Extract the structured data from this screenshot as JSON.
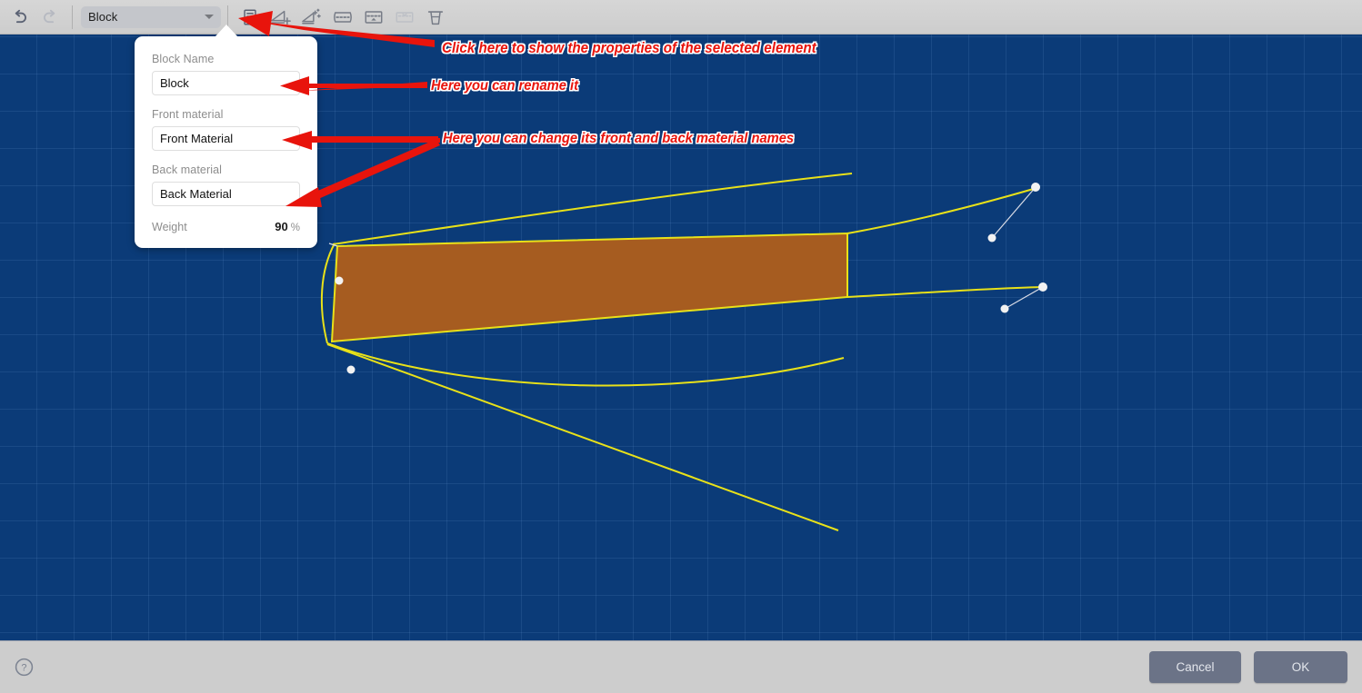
{
  "toolbar": {
    "undo_icon": "undo-arrow-icon",
    "redo_icon": "redo-arrow-icon",
    "element_select": {
      "value": "Block",
      "caret_icon": "chevron-down-icon"
    },
    "buttons": [
      {
        "name": "properties-button",
        "icon": "properties-list-icon",
        "enabled": true
      },
      {
        "name": "add-block-button",
        "icon": "add-block-icon",
        "enabled": true
      },
      {
        "name": "add-broadseam-button",
        "icon": "add-broadseam-icon",
        "enabled": true
      },
      {
        "name": "add-batten-button",
        "icon": "add-batten-icon",
        "enabled": true
      },
      {
        "name": "edit-batten-button",
        "icon": "edit-batten-icon",
        "enabled": true
      },
      {
        "name": "remove-batten-button",
        "icon": "remove-batten-icon",
        "enabled": false
      },
      {
        "name": "delete-button",
        "icon": "trash-icon",
        "enabled": true
      }
    ]
  },
  "properties_panel": {
    "block_name": {
      "label": "Block Name",
      "value": "Block",
      "placeholder": "Block Name"
    },
    "front_material": {
      "label": "Front material",
      "value": "Front Material",
      "placeholder": "Front material"
    },
    "back_material": {
      "label": "Back material",
      "value": "Back Material",
      "placeholder": "Back material"
    },
    "weight": {
      "label": "Weight",
      "value": "90",
      "unit": "%"
    }
  },
  "annotations": [
    {
      "text": "Click here to show the properties of the selected element"
    },
    {
      "text": "Here you can rename it"
    },
    {
      "text": "Here you can change its front and back material names"
    }
  ],
  "footer": {
    "help_icon": "help-circle-icon",
    "cancel_label": "Cancel",
    "ok_label": "OK"
  },
  "colors": {
    "canvas_background": "#0b3b78",
    "grid_line": "#2a5b96",
    "sail_fill": "#a65c20",
    "sail_outline": "#e8e119",
    "annotation_red": "#e8140c",
    "annotation_outline": "#ffffff",
    "control_point": "#f0f0f0",
    "button_face": "#6b7387",
    "toolbar_background": "#d2d2d2"
  }
}
